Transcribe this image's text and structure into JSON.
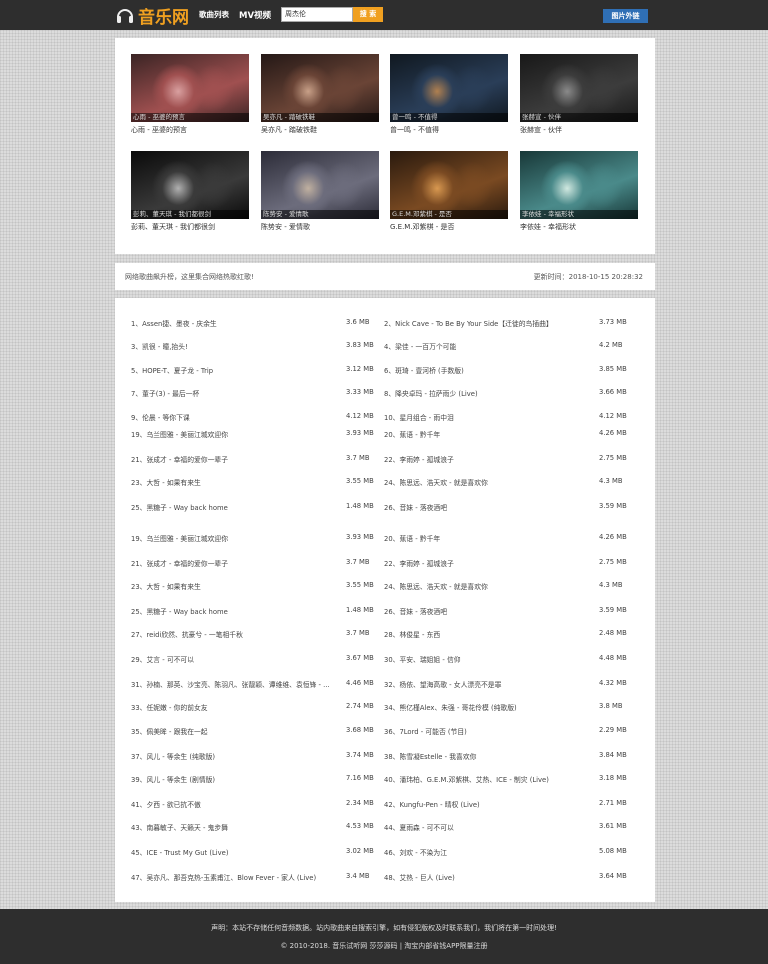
{
  "header": {
    "logo_text": "音乐网",
    "nav": [
      "歌曲列表",
      "MV视频"
    ],
    "search_value": "周杰伦",
    "search_button": "搜 索",
    "pic_link": "图片外链",
    "colors": {
      "bar": "#2e2e2e",
      "accent": "#f0a020",
      "link_button": "#2f6fb5"
    }
  },
  "mv": [
    {
      "caption": "心雨 - 巫婆的预言",
      "title": "心雨 - 巫婆的预言",
      "palette": [
        "#3a2424",
        "#a05050",
        "#d9a0a0"
      ]
    },
    {
      "caption": "吴亦凡 - 踏破铁鞋",
      "title": "吴亦凡 - 踏破铁鞋",
      "palette": [
        "#241816",
        "#6a4436",
        "#c8a088"
      ]
    },
    {
      "caption": "曾一鸣 - 不值得",
      "title": "曾一鸣 - 不值得",
      "palette": [
        "#101820",
        "#2a3e58",
        "#b08050"
      ]
    },
    {
      "caption": "张赫宣 - 伙伴",
      "title": "张赫宣 - 伙伴",
      "palette": [
        "#181818",
        "#3c3c3c",
        "#8a8a8a"
      ]
    },
    {
      "caption": "彭莉、董天琪 - 我们都很剑",
      "title": "彭莉、董天琪 - 我们都很剑",
      "palette": [
        "#0a0a0a",
        "#3a3a3a",
        "#b0b0b0"
      ]
    },
    {
      "caption": "陈势安 - 爱情歌",
      "title": "陈势安 - 爱情歌",
      "palette": [
        "#2c2c38",
        "#6c6c7c",
        "#c0b0a0"
      ]
    },
    {
      "caption": "G.E.M.邓紫棋 - 是否",
      "title": "G.E.M.邓紫棋 - 是否",
      "palette": [
        "#2a1a0e",
        "#7a4a22",
        "#d89850"
      ]
    },
    {
      "caption": "李依娃 - 幸福形状",
      "title": "李依娃 - 幸福形状",
      "palette": [
        "#183838",
        "#4a8a8a",
        "#d0e8e0"
      ]
    }
  ],
  "notice": {
    "left": "网络歌曲飙升榜，这里集合网络热歌红歌!",
    "right": "更新时间：2018-10-15 20:28:32"
  },
  "songs": [
    {
      "name": "1、Assen捷、墨夜 - 庆余生",
      "size": "3.6 MB"
    },
    {
      "name": "2、Nick Cave - To Be By Your Side【迁徙的鸟插曲】",
      "size": "3.73 MB"
    },
    {
      "name": "3、凯很 - 瞳,抬头!",
      "size": "3.83 MB"
    },
    {
      "name": "4、梁佳 - 一百万个可能",
      "size": "4.2 MB"
    },
    {
      "name": "5、HOPE-T、夏子龙 - Trip",
      "size": "3.12 MB"
    },
    {
      "name": "6、斑琦 - 壹河桥 (手数版)",
      "size": "3.85 MB"
    },
    {
      "name": "7、董子(3) - 最后一杯",
      "size": "3.33 MB"
    },
    {
      "name": "8、降央卓玛 - 拉萨雨少 (Live)",
      "size": "3.66 MB"
    },
    {
      "name": "9、伦晨 - 等你下课",
      "size": "4.12 MB"
    },
    {
      "name": "10、星月组合 - 雨中泪",
      "size": "4.12 MB"
    },
    {
      "name": "19、乌兰图雅 - 美丽江城欢迎你",
      "size": "3.93 MB"
    },
    {
      "name": "20、蕉语 - 黔千年",
      "size": "4.26 MB"
    },
    {
      "name": "21、张成才 - 幸福的爱你一辈子",
      "size": "3.7 MB"
    },
    {
      "name": "22、李雨婷 - 孤城浪子",
      "size": "2.75 MB"
    },
    {
      "name": "23、大哲 - 如果有来生",
      "size": "3.55 MB"
    },
    {
      "name": "24、陈思远、浩天欢 - 就是喜欢你",
      "size": "4.3 MB"
    },
    {
      "name": "25、黑糖子 - Way back home",
      "size": "1.48 MB"
    },
    {
      "name": "26、音妹 - 落夜酒吧",
      "size": "3.59 MB"
    },
    {
      "name": "19、乌兰图雅 - 美丽江城欢迎你",
      "size": "3.93 MB"
    },
    {
      "name": "20、蕉语 - 黔千年",
      "size": "4.26 MB"
    },
    {
      "name": "21、张成才 - 幸福的爱你一辈子",
      "size": "3.7 MB"
    },
    {
      "name": "22、李雨婷 - 孤城浪子",
      "size": "2.75 MB"
    },
    {
      "name": "23、大哲 - 如果有来生",
      "size": "3.55 MB"
    },
    {
      "name": "24、陈思远、浩天欢 - 就是喜欢你",
      "size": "4.3 MB"
    },
    {
      "name": "25、黑糖子 - Way back home",
      "size": "1.48 MB"
    },
    {
      "name": "26、音妹 - 落夜酒吧",
      "size": "3.59 MB"
    },
    {
      "name": "27、reidi欣然、抗豪兮 - 一笔相千秋",
      "size": "3.7 MB"
    },
    {
      "name": "28、林俊星 - 东西",
      "size": "2.48 MB"
    },
    {
      "name": "29、艾言 - 可不可以",
      "size": "3.67 MB"
    },
    {
      "name": "30、平安、瑞姐姐 - 信仰",
      "size": "4.48 MB"
    },
    {
      "name": "31、孙楠、那英、沙宝亮、陈羽凡、张靓颖、谭维维、袁恒锋 - ...",
      "size": "4.46 MB"
    },
    {
      "name": "32、杨依、望海高歌 - 女人漂亮不是罪",
      "size": "4.32 MB"
    },
    {
      "name": "33、任妮嫩 - 你的前女友",
      "size": "2.74 MB"
    },
    {
      "name": "34、熊亿槿Alex、朱强 - 哥花伶模 (纯歌版)",
      "size": "3.8 MB"
    },
    {
      "name": "35、佩美眸 - 跟我在一起",
      "size": "3.68 MB"
    },
    {
      "name": "36、7Lord - 可能否 (节目)",
      "size": "2.29 MB"
    },
    {
      "name": "37、风儿 - 等余生 (纯歌版)",
      "size": "3.74 MB"
    },
    {
      "name": "38、陈雪凝Estelle - 我喜欢你",
      "size": "3.84 MB"
    },
    {
      "name": "39、风儿 - 等余生 (剧情版)",
      "size": "7.16 MB"
    },
    {
      "name": "40、潘玮柏、G.E.M.邓紫棋、艾热、ICE - 制灾 (Live)",
      "size": "3.18 MB"
    },
    {
      "name": "41、夕西 - 欲已抗不傲",
      "size": "2.34 MB"
    },
    {
      "name": "42、Kungfu-Pen - 晴权 (Live)",
      "size": "2.71 MB"
    },
    {
      "name": "43、南暮敏子、天籁天 - 鬼步舞",
      "size": "4.53 MB"
    },
    {
      "name": "44、夏雨森 - 可不可以",
      "size": "3.61 MB"
    },
    {
      "name": "45、ICE - Trust My Gut (Live)",
      "size": "3.02 MB"
    },
    {
      "name": "46、刘欢 - 不染为江",
      "size": "5.08 MB"
    },
    {
      "name": "47、吴亦凡、那吾克热-玉素甫江、Blow Fever - 家人 (Live)",
      "size": "3.4 MB"
    },
    {
      "name": "48、艾热 - 巨人 (Live)",
      "size": "3.64 MB"
    }
  ],
  "footer": {
    "line1": "声明：本站不存储任何音频数据。站内歌曲来自搜索引擎，如有侵犯版权及时联系我们，我们将在第一时间处理!",
    "line2": "© 2010-2018. 音乐试听网 莎莎源码 | 淘宝内部省钱APP限量注册"
  }
}
